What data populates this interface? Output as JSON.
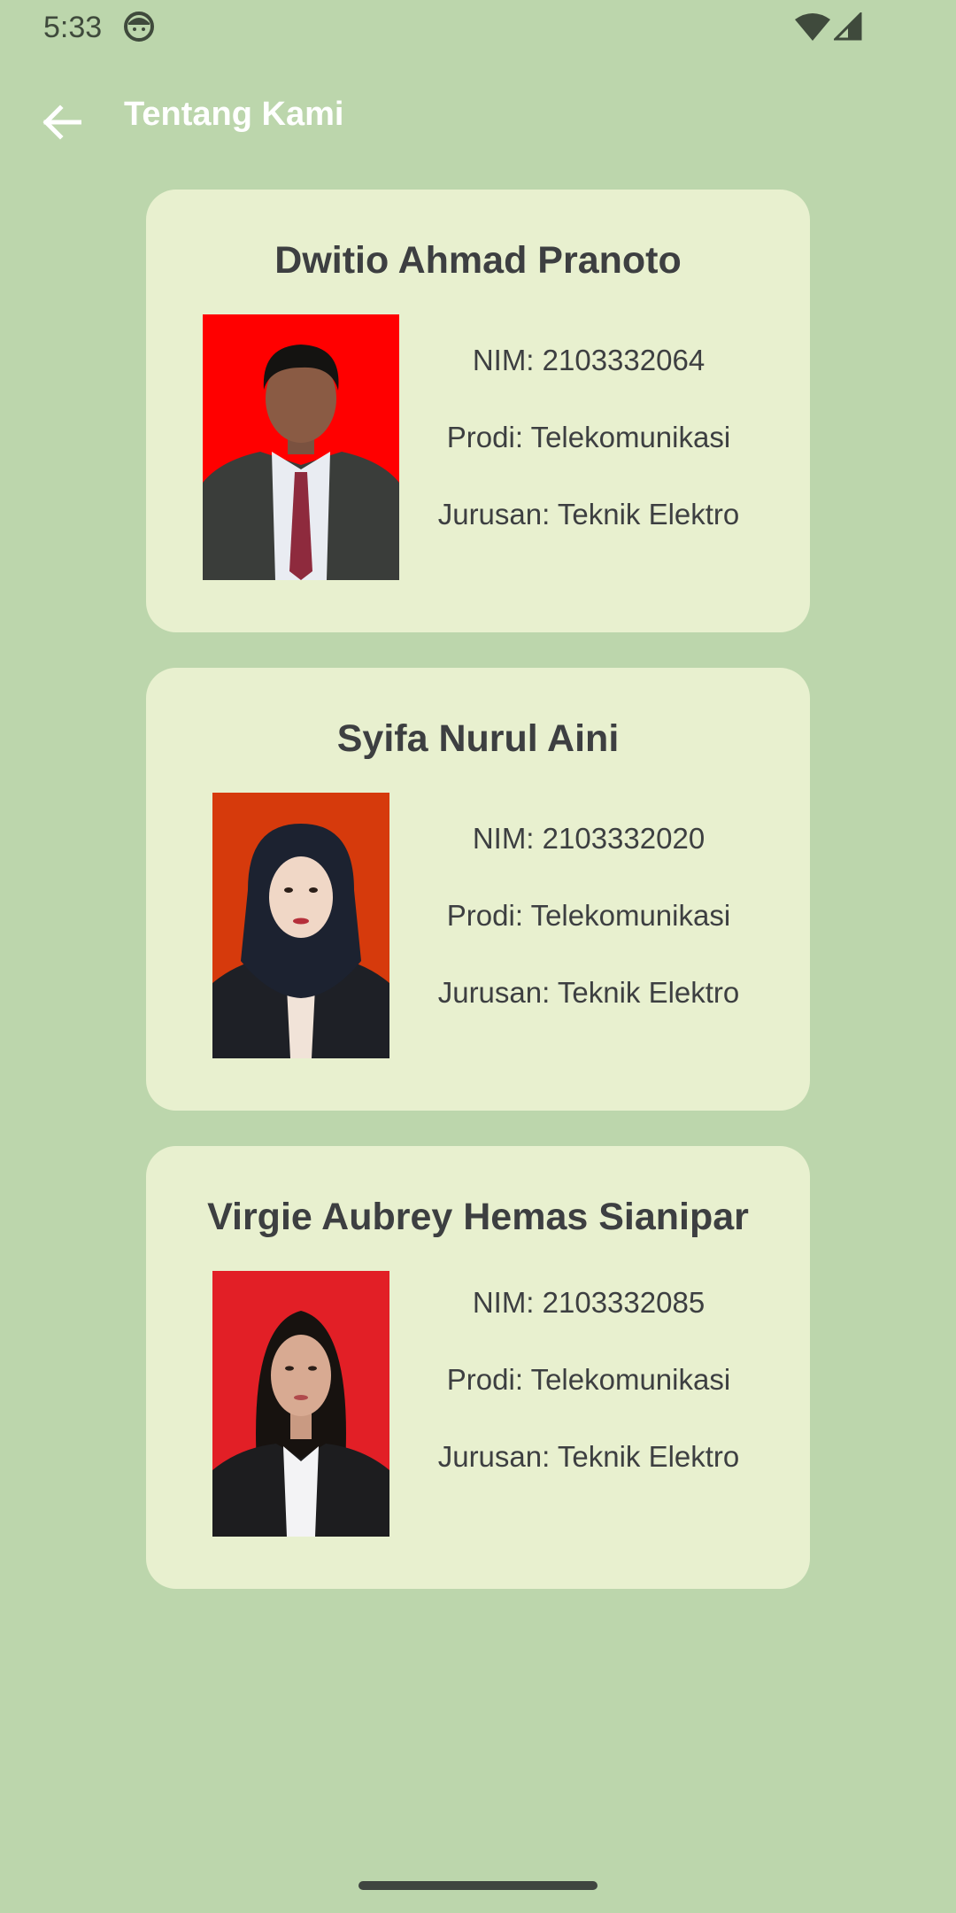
{
  "status_bar": {
    "time": "5:33",
    "app_icon": "face-icon",
    "wifi_icon": "wifi-icon",
    "signal_icon": "signal-icon"
  },
  "app_bar": {
    "back_icon": "arrow-left-icon",
    "title": "Tentang Kami"
  },
  "members": [
    {
      "name": "Dwitio Ahmad Pranoto",
      "nim": "NIM: 2103332064",
      "prodi": "Prodi: Telekomunikasi",
      "jurusan": "Jurusan: Teknik Elektro",
      "photo_bg": "#ff0000"
    },
    {
      "name": "Syifa Nurul Aini",
      "nim": "NIM: 2103332020",
      "prodi": "Prodi: Telekomunikasi",
      "jurusan": "Jurusan: Teknik Elektro",
      "photo_bg": "#d63a0c"
    },
    {
      "name": "Virgie Aubrey Hemas Sianipar",
      "nim": "NIM: 2103332085",
      "prodi": "Prodi: Telekomunikasi",
      "jurusan": "Jurusan: Teknik Elektro",
      "photo_bg": "#e21f26"
    }
  ],
  "colors": {
    "background": "#bcd6ac",
    "card": "#e8f0cf",
    "text": "#3d3f41",
    "app_bar_text": "#ffffff"
  }
}
